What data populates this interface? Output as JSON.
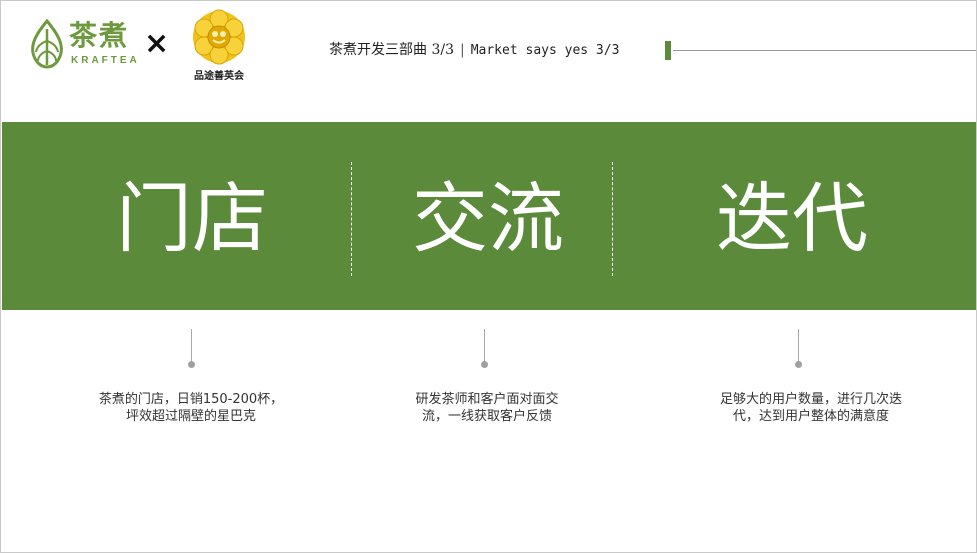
{
  "header": {
    "logo_left": {
      "icon": "tea-leaf-icon",
      "name": "茶煮",
      "subtitle": "KRAFTEA",
      "color": "#6c9a3c"
    },
    "cross": "×",
    "logo_right": {
      "icon": "golden-flower-emblem",
      "caption": "品途善英会",
      "color": "#e8b400"
    },
    "title_cn": "茶煮开发三部曲 3/3",
    "separator": "|",
    "title_en": "Market says yes 3/3",
    "accent_color": "#5b8a3a"
  },
  "band": {
    "color": "#5b8a3a",
    "words": [
      "门店",
      "交流",
      "迭代"
    ]
  },
  "descriptions": [
    {
      "line1": "茶煮的门店，日销150-200杯，",
      "line2": "坪效超过隔壁的星巴克"
    },
    {
      "line1": "研发茶师和客户面对面交",
      "line2": "流，一线获取客户反馈"
    },
    {
      "line1": "足够大的用户数量，进行几次迭",
      "line2": "代，达到用户整体的满意度"
    }
  ]
}
